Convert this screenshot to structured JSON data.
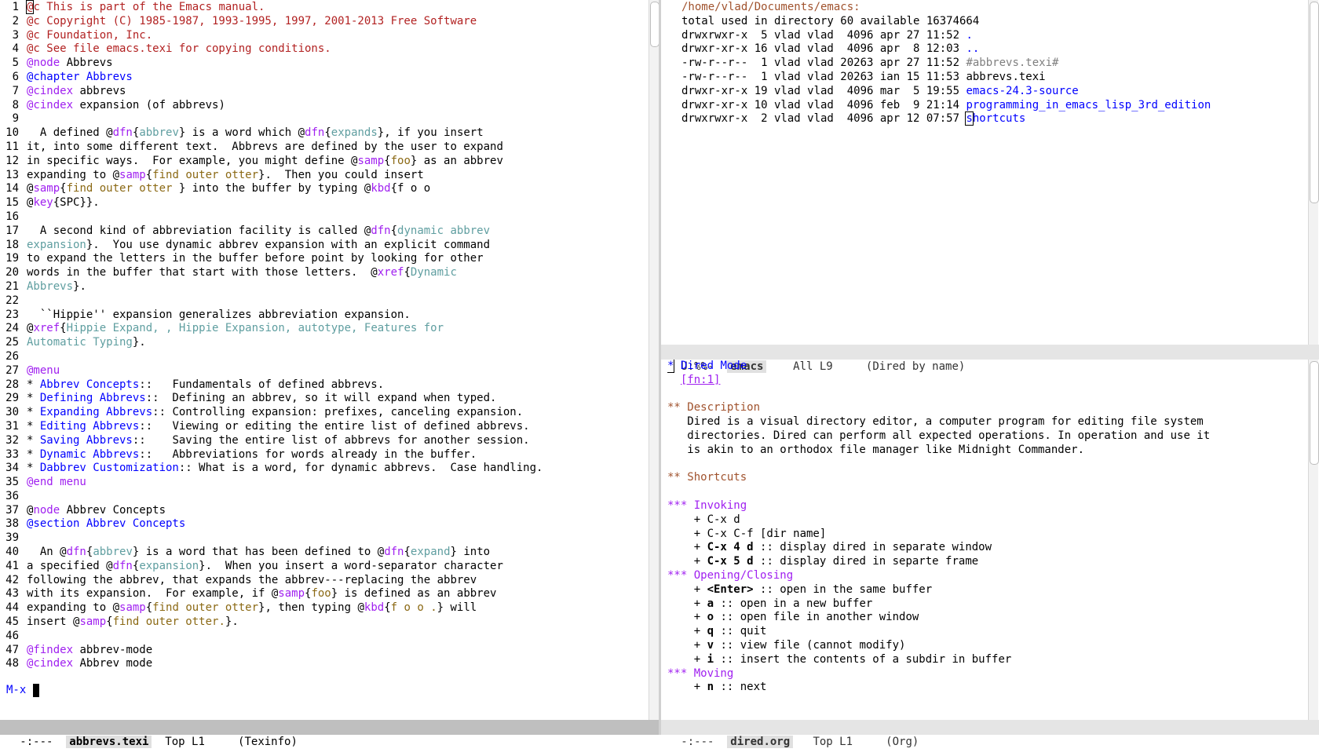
{
  "left": {
    "lines": [
      [
        {
          "t": "@c This is part of the Emacs manual.",
          "c": "cm",
          "cursor_first": true
        }
      ],
      [
        {
          "t": "@c Copyright (C) 1985-1987, 1993-1995, 1997, 2001-2013 Free Software",
          "c": "cm"
        }
      ],
      [
        {
          "t": "@c Foundation, Inc.",
          "c": "cm"
        }
      ],
      [
        {
          "t": "@c See file emacs.texi for copying conditions.",
          "c": "cm"
        }
      ],
      [
        {
          "t": "@",
          "c": "cmd"
        },
        {
          "t": "node",
          "c": "cmd"
        },
        {
          "t": " Abbrevs"
        }
      ],
      [
        {
          "t": "@chapter Abbrevs",
          "c": "sec"
        }
      ],
      [
        {
          "t": "@cindex",
          "c": "cmd"
        },
        {
          "t": " abbrevs"
        }
      ],
      [
        {
          "t": "@cindex",
          "c": "cmd"
        },
        {
          "t": " expansion (of abbrevs)"
        }
      ],
      [],
      [
        {
          "t": "  A defined @"
        },
        {
          "t": "dfn",
          "c": "cmd"
        },
        {
          "t": "{"
        },
        {
          "t": "abbrev",
          "c": "arg"
        },
        {
          "t": "} is a word which @"
        },
        {
          "t": "dfn",
          "c": "cmd"
        },
        {
          "t": "{"
        },
        {
          "t": "expands",
          "c": "arg"
        },
        {
          "t": "}, if you insert"
        }
      ],
      [
        {
          "t": "it, into some different text.  Abbrevs are defined by the user to expand"
        }
      ],
      [
        {
          "t": "in specific ways.  For example, you might define @"
        },
        {
          "t": "samp",
          "c": "cmd"
        },
        {
          "t": "{"
        },
        {
          "t": "foo",
          "c": "str"
        },
        {
          "t": "} as an abbrev"
        }
      ],
      [
        {
          "t": "expanding to @"
        },
        {
          "t": "samp",
          "c": "cmd"
        },
        {
          "t": "{"
        },
        {
          "t": "find outer otter",
          "c": "str"
        },
        {
          "t": "}.  Then you could insert"
        }
      ],
      [
        {
          "t": "@"
        },
        {
          "t": "samp",
          "c": "cmd"
        },
        {
          "t": "{"
        },
        {
          "t": "find outer otter ",
          "c": "str"
        },
        {
          "t": "} into the buffer by typing @"
        },
        {
          "t": "kbd",
          "c": "cmd"
        },
        {
          "t": "{f o o"
        }
      ],
      [
        {
          "t": "@"
        },
        {
          "t": "key",
          "c": "cmd"
        },
        {
          "t": "{SPC}}."
        }
      ],
      [],
      [
        {
          "t": "  A second kind of abbreviation facility is called @"
        },
        {
          "t": "dfn",
          "c": "cmd"
        },
        {
          "t": "{"
        },
        {
          "t": "dynamic abbrev",
          "c": "arg"
        }
      ],
      [
        {
          "t": "expansion",
          "c": "arg"
        },
        {
          "t": "}.  You use dynamic abbrev expansion with an explicit command"
        }
      ],
      [
        {
          "t": "to expand the letters in the buffer before point by looking for other"
        }
      ],
      [
        {
          "t": "words in the buffer that start with those letters.  @"
        },
        {
          "t": "xref",
          "c": "cmd"
        },
        {
          "t": "{"
        },
        {
          "t": "Dynamic",
          "c": "arg"
        }
      ],
      [
        {
          "t": "Abbrevs",
          "c": "arg"
        },
        {
          "t": "}."
        }
      ],
      [],
      [
        {
          "t": "  ``Hippie'' expansion generalizes abbreviation expansion."
        }
      ],
      [
        {
          "t": "@"
        },
        {
          "t": "xref",
          "c": "cmd"
        },
        {
          "t": "{"
        },
        {
          "t": "Hippie Expand, , Hippie Expansion, autotype, Features for",
          "c": "arg"
        }
      ],
      [
        {
          "t": "Automatic Typing",
          "c": "arg"
        },
        {
          "t": "}."
        }
      ],
      [],
      [
        {
          "t": "@menu",
          "c": "cmd"
        }
      ],
      [
        {
          "t": "* "
        },
        {
          "t": "Abbrev Concepts",
          "c": "fnc"
        },
        {
          "t": "::   Fundamentals of defined abbrevs."
        }
      ],
      [
        {
          "t": "* "
        },
        {
          "t": "Defining Abbrevs",
          "c": "fnc"
        },
        {
          "t": "::  Defining an abbrev, so it will expand when typed."
        }
      ],
      [
        {
          "t": "* "
        },
        {
          "t": "Expanding Abbrevs",
          "c": "fnc"
        },
        {
          "t": ":: Controlling expansion: prefixes, canceling expansion."
        }
      ],
      [
        {
          "t": "* "
        },
        {
          "t": "Editing Abbrevs",
          "c": "fnc"
        },
        {
          "t": "::   Viewing or editing the entire list of defined abbrevs."
        }
      ],
      [
        {
          "t": "* "
        },
        {
          "t": "Saving Abbrevs",
          "c": "fnc"
        },
        {
          "t": "::    Saving the entire list of abbrevs for another session."
        }
      ],
      [
        {
          "t": "* "
        },
        {
          "t": "Dynamic Abbrevs",
          "c": "fnc"
        },
        {
          "t": "::   Abbreviations for words already in the buffer."
        }
      ],
      [
        {
          "t": "* "
        },
        {
          "t": "Dabbrev Customization",
          "c": "fnc"
        },
        {
          "t": ":: What is a word, for dynamic abbrevs.  Case handling."
        }
      ],
      [
        {
          "t": "@end menu",
          "c": "cmd"
        }
      ],
      [],
      [
        {
          "t": "@"
        },
        {
          "t": "node",
          "c": "cmd"
        },
        {
          "t": " Abbrev Concepts"
        }
      ],
      [
        {
          "t": "@section Abbrev Concepts",
          "c": "sec"
        }
      ],
      [],
      [
        {
          "t": "  An @"
        },
        {
          "t": "dfn",
          "c": "cmd"
        },
        {
          "t": "{"
        },
        {
          "t": "abbrev",
          "c": "arg"
        },
        {
          "t": "} is a word that has been defined to @"
        },
        {
          "t": "dfn",
          "c": "cmd"
        },
        {
          "t": "{"
        },
        {
          "t": "expand",
          "c": "arg"
        },
        {
          "t": "} into"
        }
      ],
      [
        {
          "t": "a specified @"
        },
        {
          "t": "dfn",
          "c": "cmd"
        },
        {
          "t": "{"
        },
        {
          "t": "expansion",
          "c": "arg"
        },
        {
          "t": "}.  When you insert a word-separator character"
        }
      ],
      [
        {
          "t": "following the abbrev, that expands the abbrev---replacing the abbrev"
        }
      ],
      [
        {
          "t": "with its expansion.  For example, if @"
        },
        {
          "t": "samp",
          "c": "cmd"
        },
        {
          "t": "{"
        },
        {
          "t": "foo",
          "c": "str"
        },
        {
          "t": "} is defined as an abbrev"
        }
      ],
      [
        {
          "t": "expanding to @"
        },
        {
          "t": "samp",
          "c": "cmd"
        },
        {
          "t": "{"
        },
        {
          "t": "find outer otter",
          "c": "str"
        },
        {
          "t": "}, then typing @"
        },
        {
          "t": "kbd",
          "c": "cmd"
        },
        {
          "t": "{"
        },
        {
          "t": "f o o .",
          "c": "str"
        },
        {
          "t": "} will"
        }
      ],
      [
        {
          "t": "insert @"
        },
        {
          "t": "samp",
          "c": "cmd"
        },
        {
          "t": "{"
        },
        {
          "t": "find outer otter.",
          "c": "str"
        },
        {
          "t": "}."
        }
      ],
      [],
      [
        {
          "t": "@findex",
          "c": "cmd"
        },
        {
          "t": " abbrev-mode"
        }
      ],
      [
        {
          "t": "@cindex",
          "c": "cmd"
        },
        {
          "t": " Abbrev mode"
        }
      ]
    ],
    "modeline": {
      "status": " -:---  ",
      "buffer": "abbrevs.texi",
      "position": "  Top L1     ",
      "mode": "(Texinfo)"
    }
  },
  "dired": {
    "path": "/home/vlad/Documents/emacs:",
    "total": "total used in directory 60 available 16374664",
    "entries": [
      {
        "perm": "drwxrwxr-x",
        "links": " 5",
        "owner": "vlad",
        "group": "vlad",
        "size": " 4096",
        "date": "apr 27 11:52",
        "name": ".",
        "type": "dir"
      },
      {
        "perm": "drwxr-xr-x",
        "links": "16",
        "owner": "vlad",
        "group": "vlad",
        "size": " 4096",
        "date": "apr  8 12:03",
        "name": "..",
        "type": "dir"
      },
      {
        "perm": "-rw-r--r--",
        "links": " 1",
        "owner": "vlad",
        "group": "vlad",
        "size": "20263",
        "date": "apr 27 11:52",
        "name": "#abbrevs.texi#",
        "type": "auto"
      },
      {
        "perm": "-rw-r--r--",
        "links": " 1",
        "owner": "vlad",
        "group": "vlad",
        "size": "20263",
        "date": "ian 15 11:53",
        "name": "abbrevs.texi",
        "type": "file"
      },
      {
        "perm": "drwxr-xr-x",
        "links": "19",
        "owner": "vlad",
        "group": "vlad",
        "size": " 4096",
        "date": "mar  5 19:55",
        "name": "emacs-24.3-source",
        "type": "dir"
      },
      {
        "perm": "drwxr-xr-x",
        "links": "10",
        "owner": "vlad",
        "group": "vlad",
        "size": " 4096",
        "date": "feb  9 21:14",
        "name": "programming_in_emacs_lisp_3rd_edition",
        "type": "dir"
      },
      {
        "perm": "drwxrwxr-x",
        "links": " 2",
        "owner": "vlad",
        "group": "vlad",
        "size": " 4096",
        "date": "apr 12 07:57",
        "name": "shortcuts",
        "type": "dir",
        "cursor": true
      }
    ],
    "modeline": {
      "status": " U:%%-  ",
      "buffer": "emacs",
      "position": "    All L9     ",
      "mode": "(Dired by name)"
    }
  },
  "org": {
    "lines": [
      [
        {
          "t": "*",
          "c": "h1",
          "cursor": true
        },
        {
          "t": " Dired Mode",
          "c": "h1"
        }
      ],
      [
        {
          "t": "  "
        },
        {
          "t": "[fn:1]",
          "c": "fn"
        }
      ],
      [],
      [
        {
          "t": "** Description",
          "c": "h2"
        }
      ],
      [
        {
          "t": "   Dired is a visual directory editor, a computer program for editing file system"
        }
      ],
      [
        {
          "t": "   directories. Dired can perform all expected operations. In operation and use it"
        }
      ],
      [
        {
          "t": "   is akin to an orthodox file manager like Midnight Commander."
        }
      ],
      [],
      [
        {
          "t": "** Shortcuts",
          "c": "h2"
        }
      ],
      [],
      [
        {
          "t": "*** Invoking",
          "c": "h3"
        }
      ],
      [
        {
          "t": "    + C-x d"
        }
      ],
      [
        {
          "t": "    + C-x C-f [dir name]"
        }
      ],
      [
        {
          "t": "    + "
        },
        {
          "t": "C-x 4 d",
          "c": "b"
        },
        {
          "t": " :: display dired in separate window"
        }
      ],
      [
        {
          "t": "    + "
        },
        {
          "t": "C-x 5 d",
          "c": "b"
        },
        {
          "t": " :: display dired in separte frame"
        }
      ],
      [
        {
          "t": "*** Opening/Closing",
          "c": "h3"
        }
      ],
      [
        {
          "t": "    + "
        },
        {
          "t": "<Enter>",
          "c": "b"
        },
        {
          "t": " :: open in the same buffer"
        }
      ],
      [
        {
          "t": "    + "
        },
        {
          "t": "a",
          "c": "b"
        },
        {
          "t": " :: open in a new buffer"
        }
      ],
      [
        {
          "t": "    + "
        },
        {
          "t": "o",
          "c": "b"
        },
        {
          "t": " :: open file in another window"
        }
      ],
      [
        {
          "t": "    + "
        },
        {
          "t": "q",
          "c": "b"
        },
        {
          "t": " :: quit"
        }
      ],
      [
        {
          "t": "    + "
        },
        {
          "t": "v",
          "c": "b"
        },
        {
          "t": " :: view file (cannot modify)"
        }
      ],
      [
        {
          "t": "    + "
        },
        {
          "t": "i",
          "c": "b"
        },
        {
          "t": " :: insert the contents of a subdir in buffer"
        }
      ],
      [
        {
          "t": "*** Moving",
          "c": "h3"
        }
      ],
      [
        {
          "t": "    + "
        },
        {
          "t": "n",
          "c": "b"
        },
        {
          "t": " :: next"
        }
      ]
    ],
    "modeline": {
      "status": " -:---  ",
      "buffer": "dired.org",
      "position": "   Top L1     ",
      "mode": "(Org)"
    }
  },
  "minibuffer": {
    "prompt": "M-x "
  }
}
